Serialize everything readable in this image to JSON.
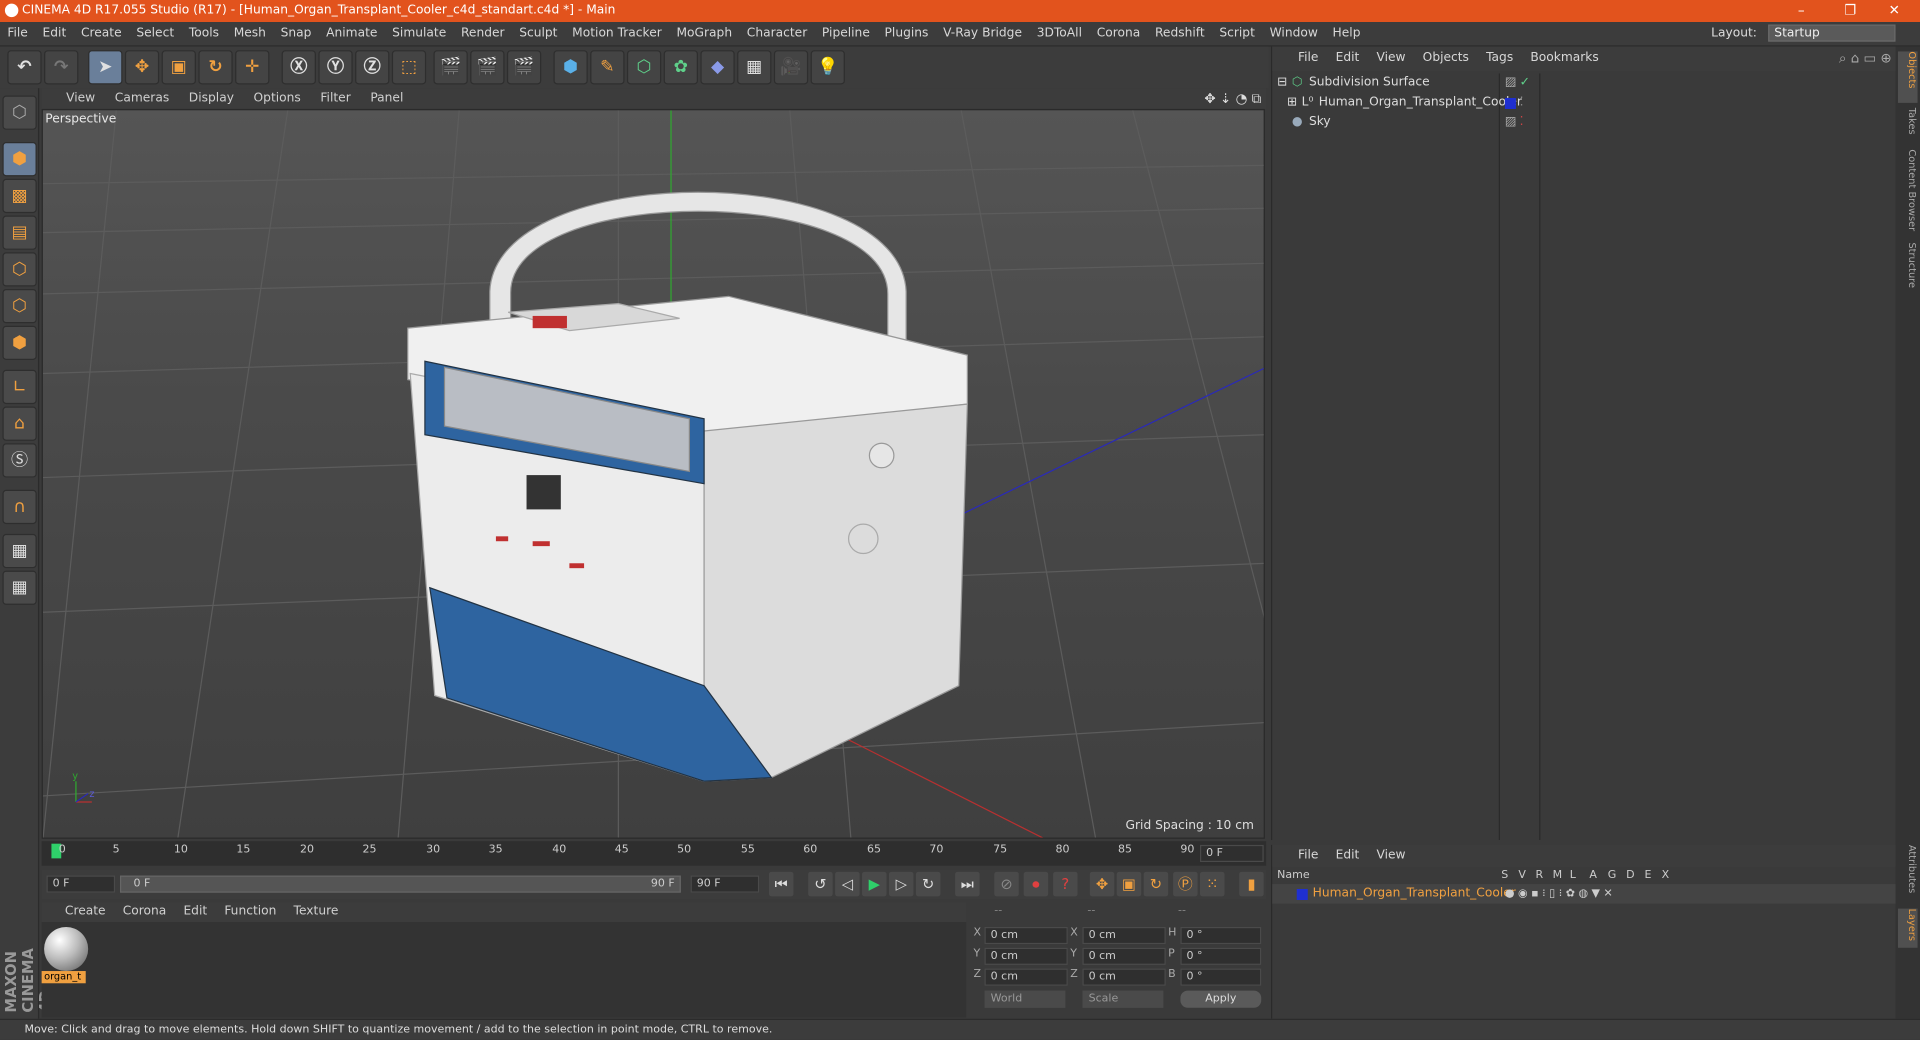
{
  "title": "CINEMA 4D R17.055 Studio (R17) - [Human_Organ_Transplant_Cooler_c4d_standart.c4d *] - Main",
  "menu": [
    "File",
    "Edit",
    "Create",
    "Select",
    "Tools",
    "Mesh",
    "Snap",
    "Animate",
    "Simulate",
    "Render",
    "Sculpt",
    "Motion Tracker",
    "MoGraph",
    "Character",
    "Pipeline",
    "Plugins",
    "V-Ray Bridge",
    "3DToAll",
    "Corona",
    "Redshift",
    "Script",
    "Window",
    "Help"
  ],
  "layout": {
    "label": "Layout:",
    "value": "Startup"
  },
  "viewport": {
    "menu": [
      "View",
      "Cameras",
      "Display",
      "Options",
      "Filter",
      "Panel"
    ],
    "label": "Perspective",
    "grid": "Grid Spacing : 10 cm"
  },
  "timeline": {
    "ticks": [
      "0",
      "5",
      "10",
      "15",
      "20",
      "25",
      "30",
      "35",
      "40",
      "45",
      "50",
      "55",
      "60",
      "65",
      "70",
      "75",
      "80",
      "85",
      "90"
    ],
    "current": "0 F",
    "start": "0 F",
    "range_start": "0 F",
    "range_end": "90 F",
    "end": "90 F"
  },
  "material": {
    "menu": [
      "Create",
      "Corona",
      "Edit",
      "Function",
      "Texture"
    ],
    "name": "organ_t"
  },
  "coords": {
    "head": [
      "--",
      "--",
      "--"
    ],
    "rows": [
      [
        "X",
        "0 cm",
        "X",
        "0 cm",
        "H",
        "0 °"
      ],
      [
        "Y",
        "0 cm",
        "Y",
        "0 cm",
        "P",
        "0 °"
      ],
      [
        "Z",
        "0 cm",
        "Z",
        "0 cm",
        "B",
        "0 °"
      ]
    ],
    "world": "World",
    "scale": "Scale",
    "apply": "Apply"
  },
  "objects": {
    "menu": [
      "File",
      "Edit",
      "View",
      "Objects",
      "Tags",
      "Bookmarks"
    ],
    "rows": [
      "Subdivision Surface",
      "Human_Organ_Transplant_Cooler",
      "Sky"
    ]
  },
  "layers": {
    "menu": [
      "File",
      "Edit",
      "View"
    ],
    "name_header": "Name",
    "cols": [
      "S",
      "V",
      "R",
      "M",
      "L",
      "A",
      "G",
      "D",
      "E",
      "X"
    ],
    "row": "Human_Organ_Transplant_Cooler"
  },
  "sidetabs": [
    "Objects",
    "Takes",
    "Content Browser",
    "Structure"
  ],
  "sidetabs2": [
    "Attributes",
    "Layers"
  ],
  "brand": "MAXON CINEMA 4D",
  "status": "Move: Click and drag to move elements. Hold down SHIFT to quantize movement / add to the selection in point mode, CTRL to remove.",
  "colors": {
    "title": "#e2531d",
    "accent": "#f0a040",
    "layer": "#1f2fd0"
  }
}
